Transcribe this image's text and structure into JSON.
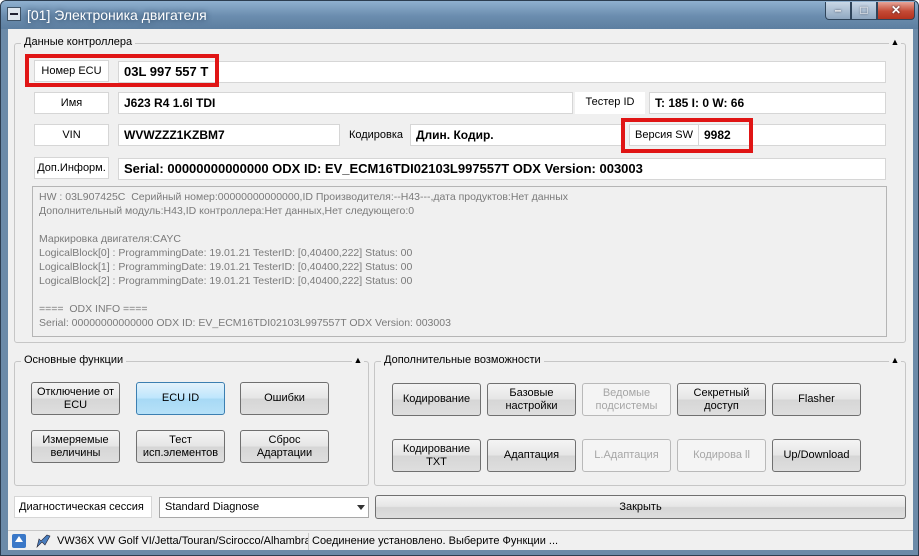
{
  "window": {
    "title": "[01] Электроника двигателя"
  },
  "controller": {
    "group_label": "Данные контроллера",
    "ecu_label": "Номер ECU",
    "ecu_value": "03L 997 557 T",
    "name_label": "Имя",
    "name_value": "J623  R4 1.6l TDI",
    "tester_label": "Тестер ID",
    "tester_value": "T: 185 I: 0 W: 66",
    "vin_label": "VIN",
    "vin_value": "WVWZZZ1KZBM7",
    "coding_label": "Кодировка",
    "coding_value": "Длин. Кодир.",
    "sw_label": "Версия SW",
    "sw_value": "9982",
    "extra_label": "Доп.Информ.",
    "extra_value": "Serial: 00000000000000 ODX ID: EV_ECM16TDI02103L997557T ODX Version: 003003",
    "info_lines": "HW : 03L907425C  Серийный номер:00000000000000,ID Производителя:--H43---,дата продуктов:Нет данных\nДополнительный модуль:H43,ID контроллера:Нет данных,Нет следующего:0\n\nМаркировка двигателя:CAYC\nLogicalBlock[0] : ProgrammingDate: 19.01.21 TesterID: [0,40400,222] Status: 00\nLogicalBlock[1] : ProgrammingDate: 19.01.21 TesterID: [0,40400,222] Status: 00\nLogicalBlock[2] : ProgrammingDate: 19.01.21 TesterID: [0,40400,222] Status: 00\n\n====  ODX INFO ====\nSerial: 00000000000000 ODX ID: EV_ECM16TDI02103L997557T ODX Version: 003003"
  },
  "main_functions": {
    "group_label": "Основные функции",
    "buttons": [
      "Отключение от\nECU",
      "ECU ID",
      "Ошибки",
      "Измеряемые\nвеличины",
      "Тест\nисп.элементов",
      "Сброс\nАдартации"
    ]
  },
  "extra_functions": {
    "group_label": "Дополнительные возможности",
    "buttons": [
      "Кодирование",
      "Базовые\nнастройки",
      "Ведомые\nподсистемы",
      "Секретный\nдоступ",
      "Flasher",
      "Кодирование\nTXT",
      "Адаптация",
      "L.Адаптация",
      "Кодирова ll",
      "Up/Download"
    ]
  },
  "session": {
    "label": "Диагностическая сессия",
    "selected": "Standard Diagnose"
  },
  "close_label": "Закрыть",
  "status": {
    "vehicle": "VW36X VW Golf VI/Jetta/Touran/Scirocco/Alhambra",
    "message": "Соединение установлено. Выберите Функции ..."
  },
  "colors": {
    "highlight": "#e01515",
    "title_bar": "#6a8cae",
    "active_button": "#bee6fd"
  }
}
